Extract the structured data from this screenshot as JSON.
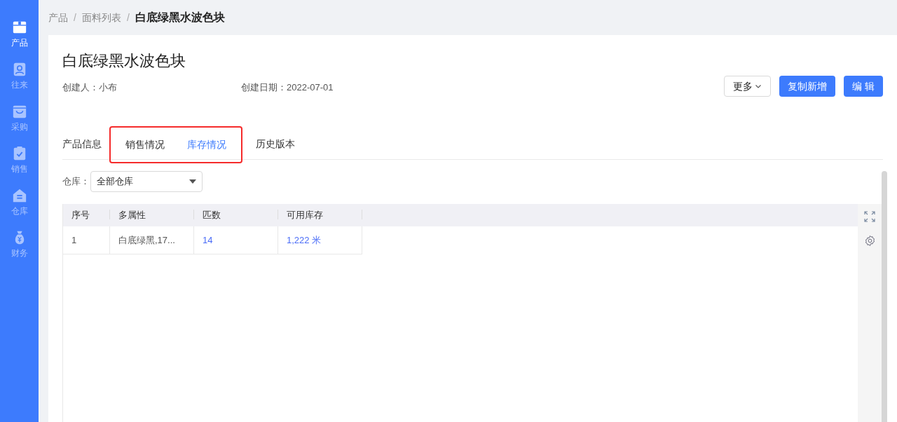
{
  "sidebar": {
    "items": [
      {
        "label": "产品",
        "kind": "box",
        "selected": true
      },
      {
        "label": "往来",
        "kind": "contact",
        "selected": false
      },
      {
        "label": "采购",
        "kind": "basket",
        "selected": false
      },
      {
        "label": "销售",
        "kind": "clipboard",
        "selected": false
      },
      {
        "label": "仓库",
        "kind": "house",
        "selected": false
      },
      {
        "label": "财务",
        "kind": "moneybag",
        "selected": false
      }
    ]
  },
  "breadcrumb": [
    {
      "kind": "link",
      "text": "产品"
    },
    {
      "kind": "separator",
      "text": "/"
    },
    {
      "kind": "link",
      "text": "面料列表"
    },
    {
      "kind": "separator",
      "text": "/"
    },
    {
      "kind": "current",
      "text": "白底绿黑水波色块"
    }
  ],
  "title": "白底绿黑水波色块",
  "meta": [
    {
      "label": "创建人：",
      "value": "小布"
    },
    {
      "label": "创建日期：",
      "value": "2022-07-01"
    }
  ],
  "actions": [
    {
      "label": "更多",
      "kind": "dropdown"
    },
    {
      "label": "复制新增",
      "kind": "primary"
    },
    {
      "label": "编 辑",
      "kind": "primary"
    }
  ],
  "tabs": [
    {
      "label": "产品信息",
      "selected": false,
      "highlighted": false
    },
    {
      "label": "销售情况",
      "selected": false,
      "highlighted": true
    },
    {
      "label": "库存情况",
      "selected": true,
      "highlighted": true
    },
    {
      "label": "历史版本",
      "selected": false,
      "highlighted": false
    }
  ],
  "warehouse": {
    "label": "仓库：",
    "value": "全部仓库"
  },
  "table": {
    "columns": [
      "序号",
      "多属性",
      "匹数",
      "可用库存"
    ],
    "rows": [
      [
        {
          "text": "1",
          "link": false
        },
        {
          "text": "白底绿黑,17...",
          "link": false
        },
        {
          "text": "14",
          "link": true
        },
        {
          "text": "1,222 米",
          "link": true
        }
      ]
    ]
  }
}
